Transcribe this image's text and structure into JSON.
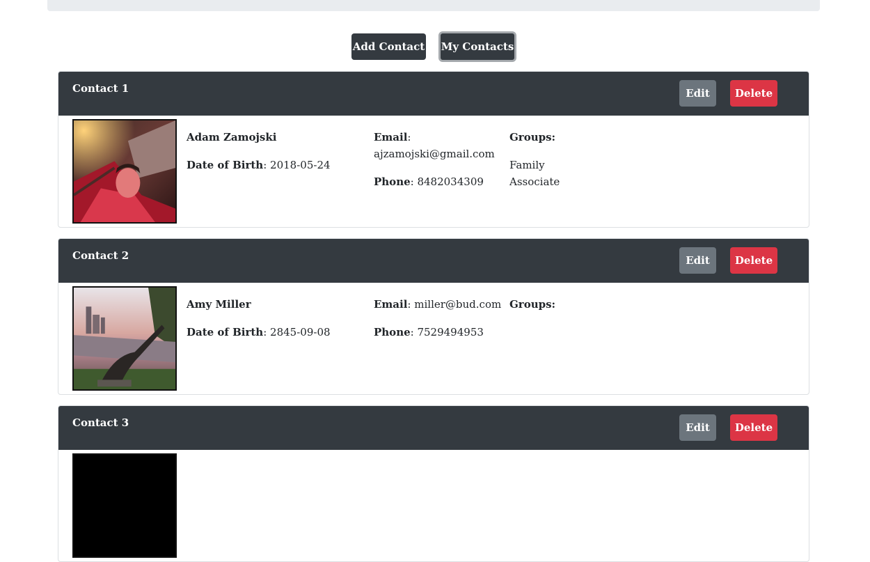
{
  "nav": {
    "add_contact_label": "Add Contact",
    "my_contacts_label": "My Contacts"
  },
  "labels": {
    "edit": "Edit",
    "delete": "Delete",
    "email": "Email",
    "phone": "Phone",
    "dob": "Date of Birth",
    "groups": "Groups:"
  },
  "contacts": [
    {
      "title": "Contact 1",
      "name": "Adam Zamojski",
      "dob": "2018-05-24",
      "email": "ajzamojski@gmail.com",
      "phone": "8482034309",
      "groups": [
        "Family",
        "Associate"
      ],
      "photo": "portrait-red-neon-photo"
    },
    {
      "title": "Contact 2",
      "name": "Amy Miller",
      "dob": "2845-09-08",
      "email": "miller@bud.com",
      "phone": "7529494953",
      "groups": [],
      "photo": "city-statue-sunset-photo"
    },
    {
      "title": "Contact 3",
      "photo": "dark-photo"
    }
  ],
  "colors": {
    "header_bg": "#343a40",
    "edit_bg": "#6c757d",
    "delete_bg": "#dc3545",
    "top_bar_bg": "#e9ecef"
  }
}
